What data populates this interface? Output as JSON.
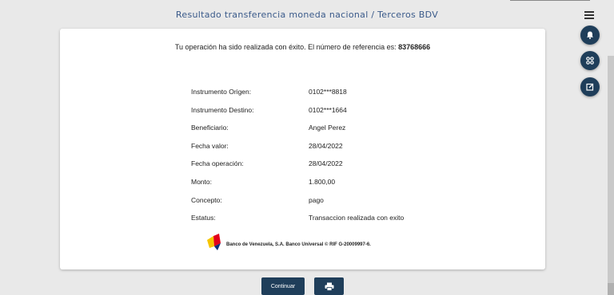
{
  "header": {
    "title": "Resultado transferencia moneda nacional / Terceros BDV"
  },
  "icons": {
    "menu": "hamburger-icon",
    "fab_1": "bell-icon",
    "fab_2": "apps-icon",
    "fab_3": "edit-icon",
    "print": "printer-icon",
    "logo": "bdv-logo-icon"
  },
  "colors": {
    "primary": "#1f3e5a",
    "title": "#3a5a8a"
  },
  "result": {
    "message_prefix": "Tu operación ha sido realizada con éxito. El número de referencia es: ",
    "reference": "83768666",
    "rows": [
      {
        "label": "Instrumento Origen:",
        "value": "0102***8818"
      },
      {
        "label": "Instrumento Destino:",
        "value": "0102***1664"
      },
      {
        "label": "Beneficiario:",
        "value": "Angel Perez"
      },
      {
        "label": "Fecha valor:",
        "value": "28/04/2022"
      },
      {
        "label": "Fecha operación:",
        "value": "28/04/2022"
      },
      {
        "label": "Monto:",
        "value": "1.800,00"
      },
      {
        "label": "Concepto:",
        "value": "pago"
      },
      {
        "label": "Estatus:",
        "value": "Transaccion realizada con exito"
      }
    ],
    "footer_text": "Banco de Venezuela, S.A. Banco Universal © RIF G-20009997-6."
  },
  "actions": {
    "continue_label": "Continuar"
  }
}
